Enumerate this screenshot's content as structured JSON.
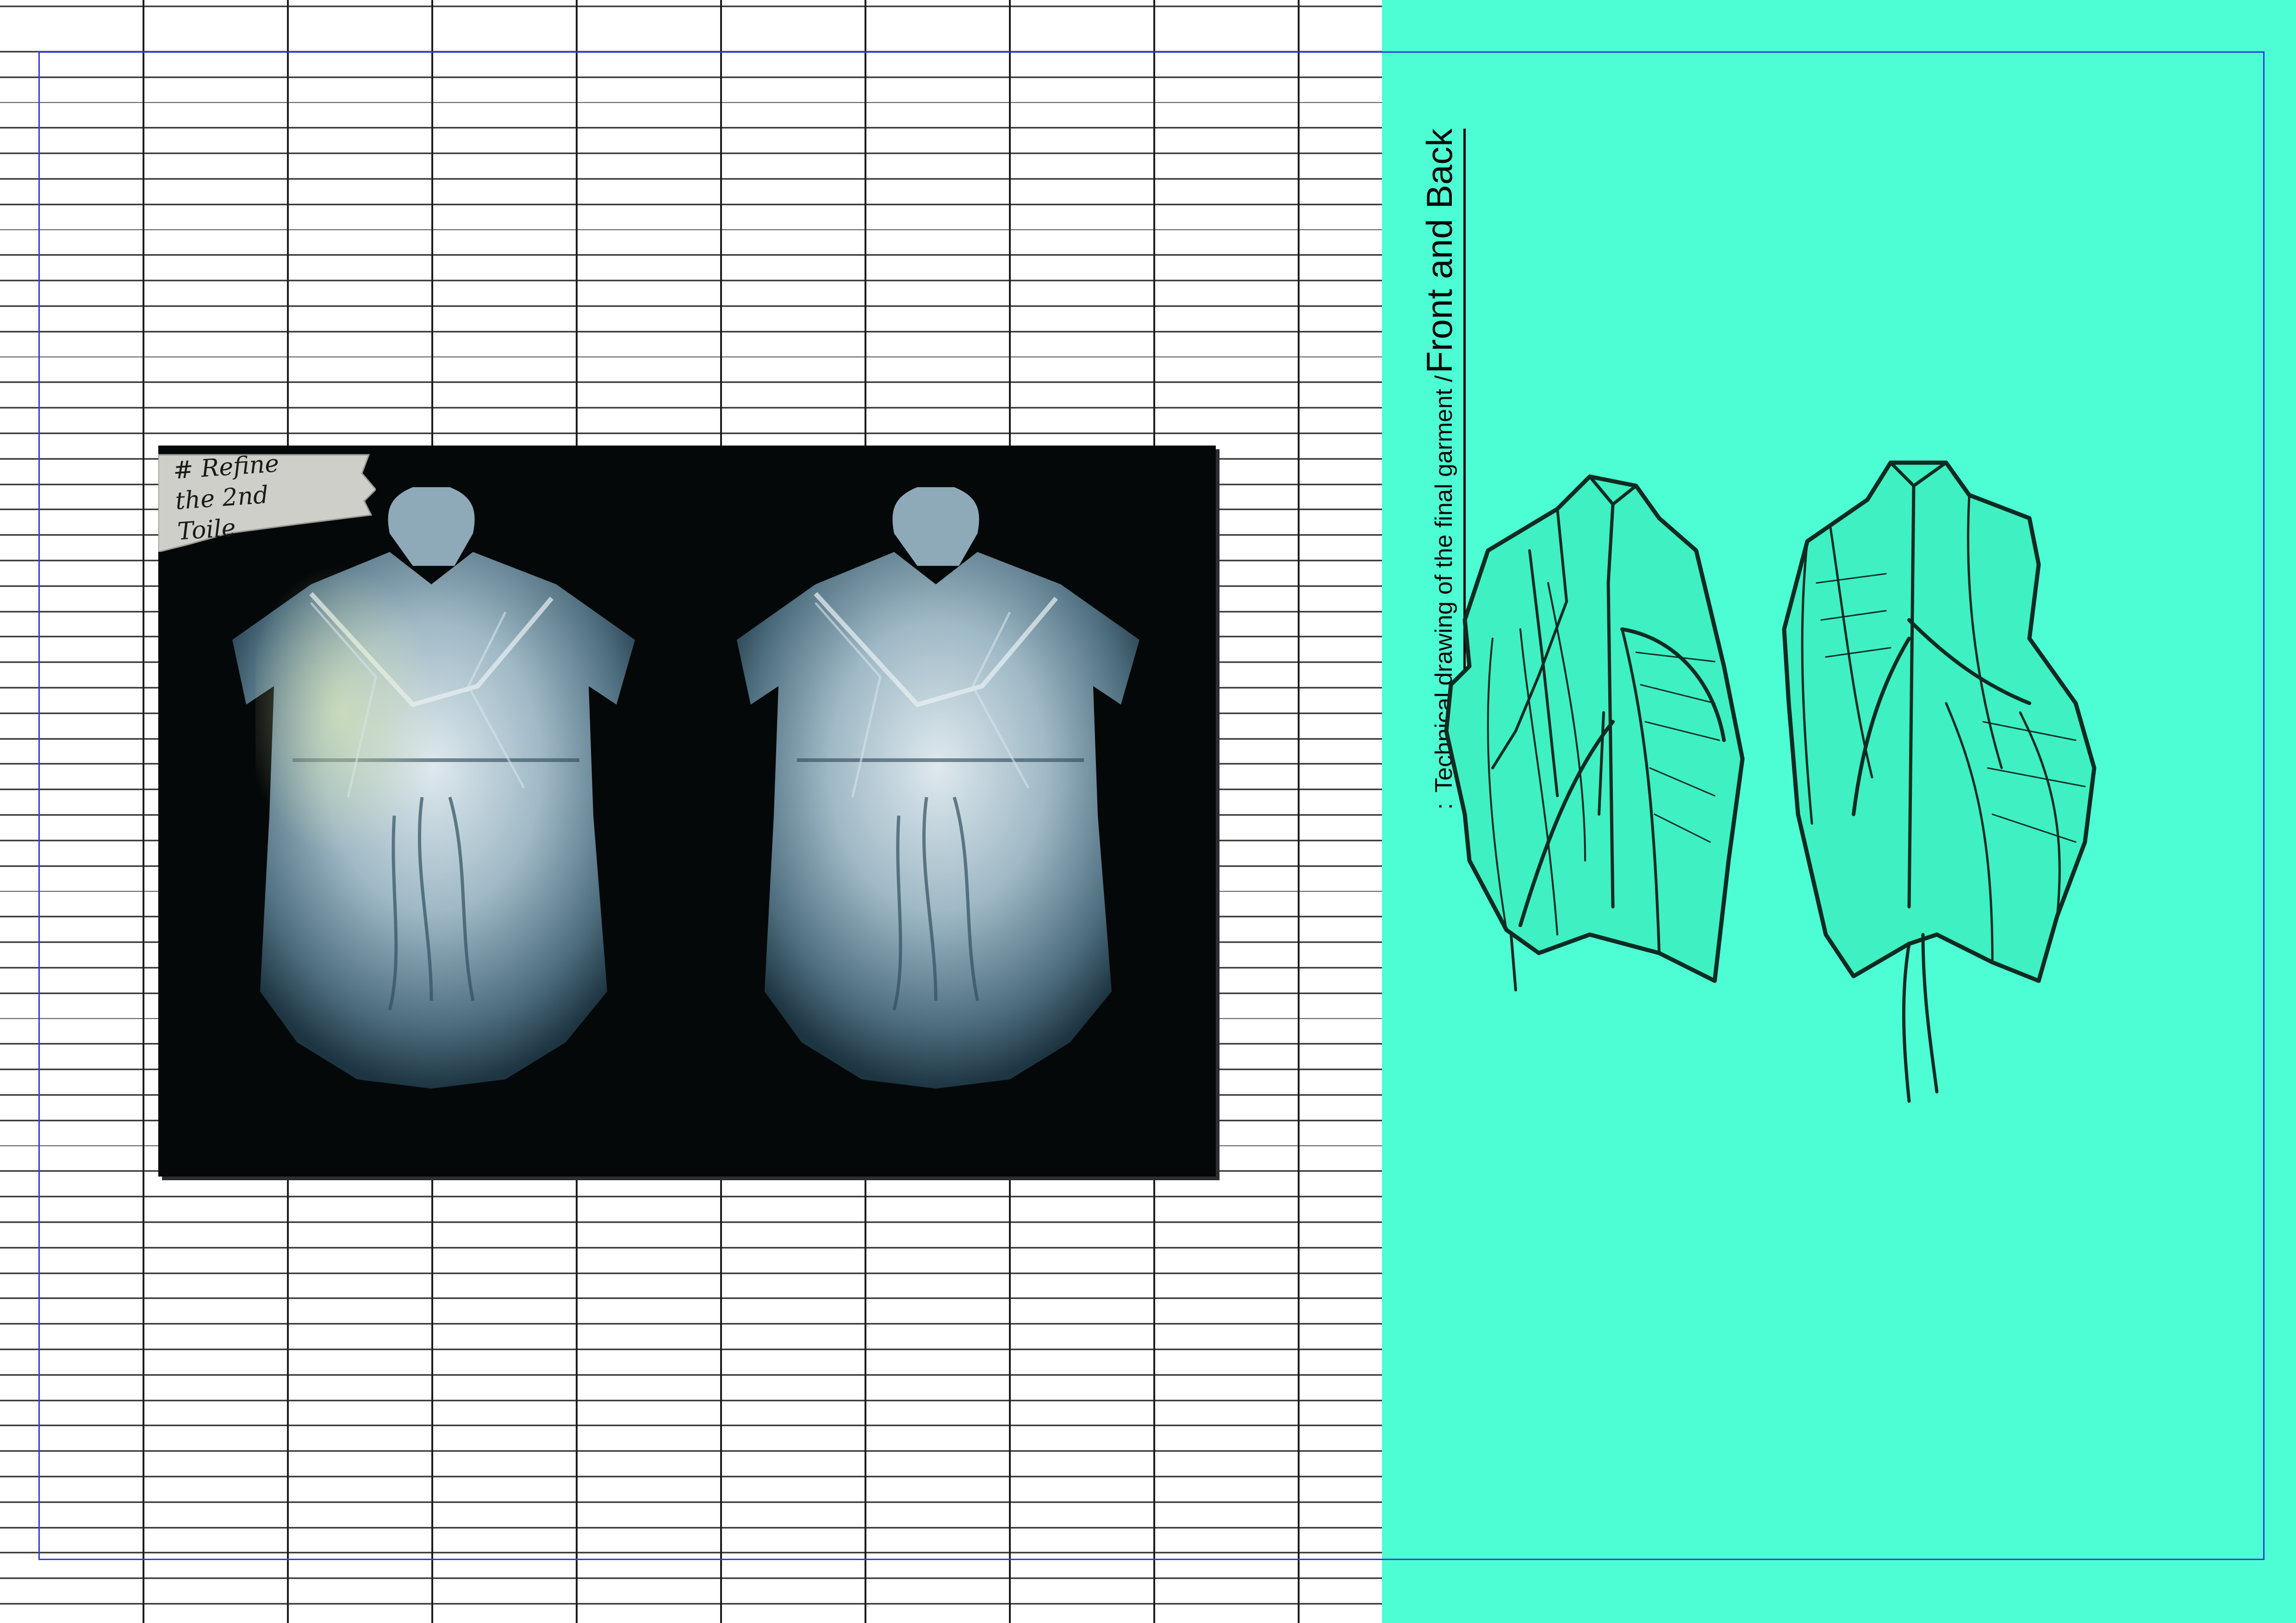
{
  "left_page": {
    "photo_note": {
      "line1": "# Refine",
      "line2": "the 2nd Toile"
    }
  },
  "right_page": {
    "caption": {
      "prefix": ":",
      "small_text": "Technical drawing of the final garment /",
      "large_text": "Front  and Back"
    }
  },
  "colors": {
    "accent_teal": "#4dfed4",
    "frame_blue": "#2f3bd8",
    "grid_line": "#2a2a2a"
  },
  "images": {
    "toile_photo": "garment-toile-photo",
    "technical_drawing": "garment-technical-drawing"
  }
}
